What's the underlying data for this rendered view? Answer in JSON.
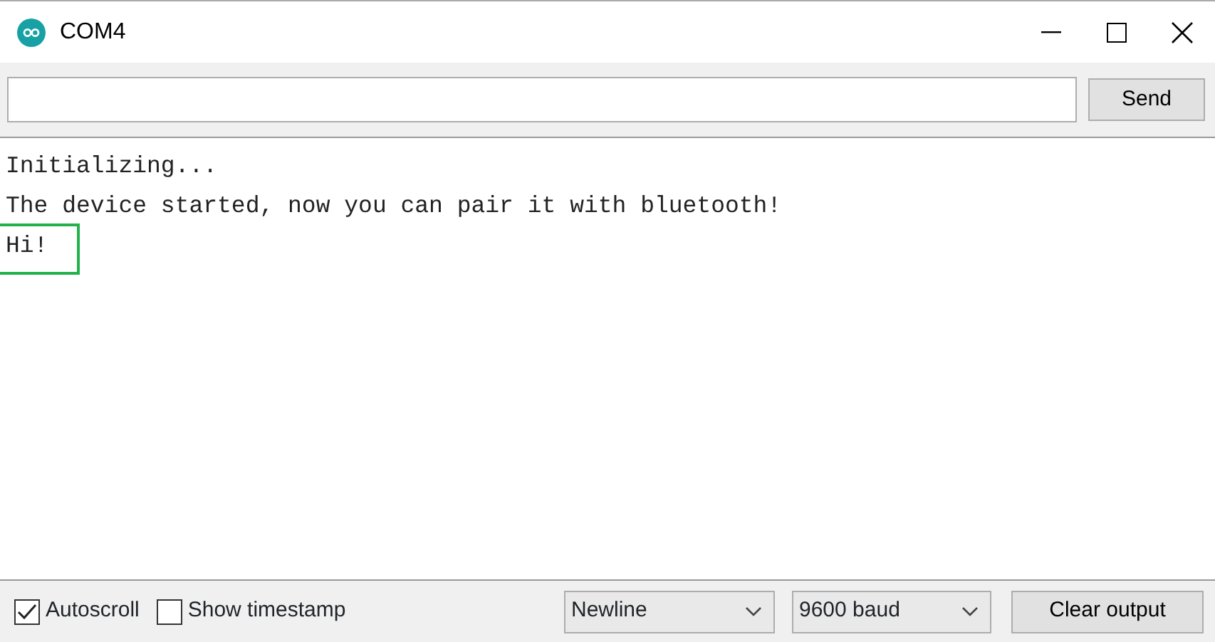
{
  "window": {
    "title": "COM4"
  },
  "send_bar": {
    "button": "Send"
  },
  "output_lines": [
    {
      "text": "Initializing...",
      "highlighted": false
    },
    {
      "text": "The device started, now you can pair it with bluetooth!",
      "highlighted": false
    },
    {
      "text": "Hi!",
      "highlighted": true
    }
  ],
  "options": [
    {
      "label": "Autoscroll",
      "checked": true
    },
    {
      "label": "Show timestamp",
      "checked": false
    }
  ],
  "line_ending": "Newline",
  "baud_rate": "9600 baud",
  "clear_button": "Clear output"
}
